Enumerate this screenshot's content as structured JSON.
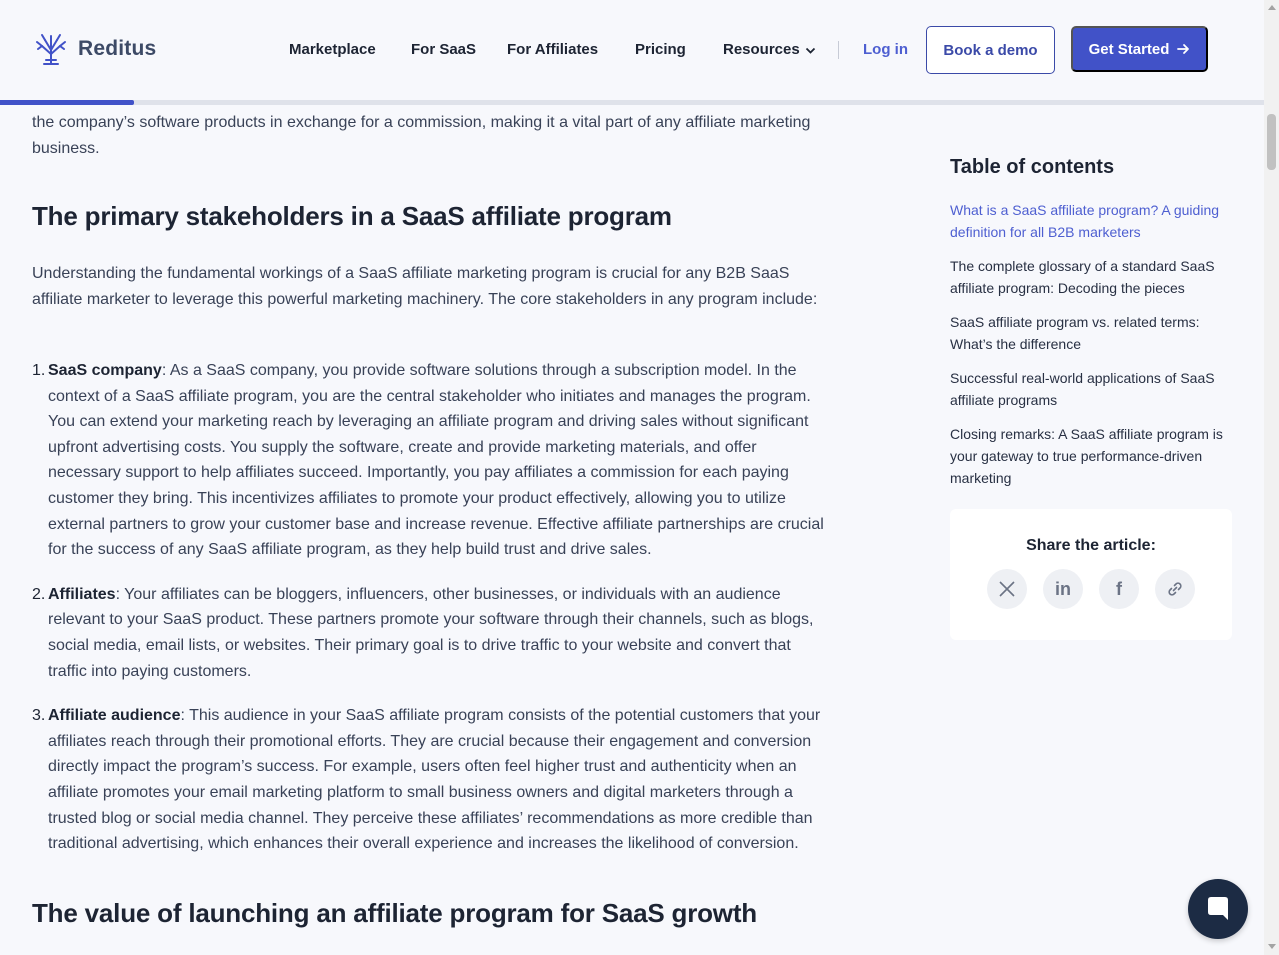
{
  "brand": {
    "name": "Reditus"
  },
  "nav": {
    "items": [
      "Marketplace",
      "For SaaS",
      "For Affiliates",
      "Pricing",
      "Resources"
    ],
    "login": "Log in",
    "book_demo": "Book a demo",
    "get_started": "Get Started"
  },
  "reading_progress": 0.106,
  "article": {
    "intro_tail": "the company’s software products in exchange for a commission, making it a vital part of any affiliate marketing business.",
    "heading_stakeholders": "The primary stakeholders in a SaaS affiliate program",
    "stakeholders_intro": "Understanding the fundamental workings of a SaaS affiliate marketing program is crucial for any B2B SaaS affiliate marketer to leverage this powerful marketing machinery. The core stakeholders in any program include:",
    "list": [
      {
        "num": "1.",
        "term": "SaaS company",
        "text": ": As a SaaS company, you provide software solutions through a subscription model. In the context of a SaaS affiliate program, you are the central stakeholder who initiates and manages the program. You can extend your marketing reach by leveraging an affiliate program and driving sales without significant upfront advertising costs. You supply the software, create and provide marketing materials, and offer necessary support to help affiliates succeed. Importantly, you pay affiliates a commission for each paying customer they bring. This incentivizes affiliates to promote your product effectively, allowing you to utilize external partners to grow your customer base and increase revenue. Effective affiliate partnerships are crucial for the success of any SaaS affiliate program, as they help build trust and drive sales."
      },
      {
        "num": "2.",
        "term": "Affiliates",
        "text": ": Your affiliates can be bloggers, influencers, other businesses, or individuals with an audience relevant to your SaaS product. These partners promote your software through their channels, such as blogs, social media, email lists, or websites. Their primary goal is to drive traffic to your website and convert that traffic into paying customers."
      },
      {
        "num": "3.",
        "term": "Affiliate audience",
        "text": ": This audience in your SaaS affiliate program consists of the potential customers that your affiliates reach through their promotional efforts. They are crucial because their engagement and conversion directly impact the program’s success. For example, users often feel higher trust and authenticity when an affiliate promotes your email marketing platform to small business owners and digital marketers through a trusted blog or social media channel. They perceive these affiliates’ recommendations as more credible than traditional advertising, which enhances their overall experience and increases the likelihood of conversion."
      }
    ],
    "heading_value": "The value of launching an affiliate program for SaaS growth"
  },
  "toc": {
    "title": "Table of contents",
    "items": [
      "What is a SaaS affiliate program? A guiding definition for all B2B marketers",
      "The complete glossary of a standard SaaS affiliate program: Decoding the pieces",
      "SaaS affiliate program vs. related terms: What’s the difference",
      "Successful real-world applications of SaaS affiliate programs",
      "Closing remarks: A SaaS affiliate program is your gateway to true performance-driven marketing"
    ]
  },
  "share": {
    "title": "Share the article:",
    "icons": [
      "x-icon",
      "linkedin-icon",
      "facebook-icon",
      "link-icon"
    ]
  },
  "colors": {
    "accent": "#4152c8",
    "link": "#4e5fd1",
    "text": "#1d2433",
    "chat": "#1c2b44"
  }
}
